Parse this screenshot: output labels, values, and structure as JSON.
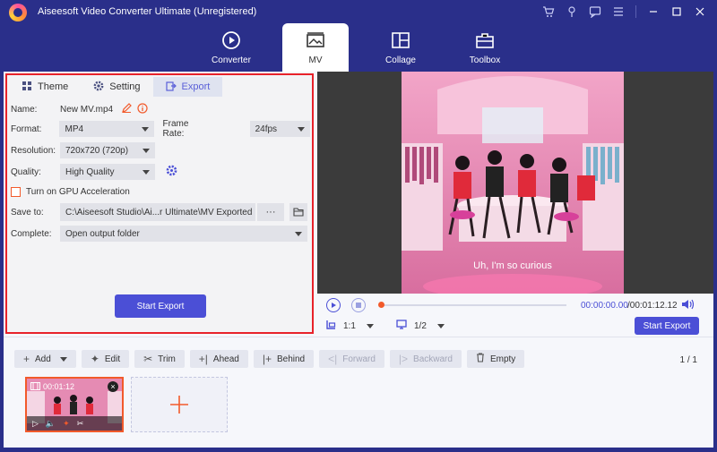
{
  "window": {
    "title": "Aiseesoft Video Converter Ultimate (Unregistered)"
  },
  "nav": {
    "converter": "Converter",
    "mv": "MV",
    "collage": "Collage",
    "toolbox": "Toolbox"
  },
  "tabs": {
    "theme": "Theme",
    "setting": "Setting",
    "export": "Export"
  },
  "export": {
    "name_label": "Name:",
    "name_value": "New MV.mp4",
    "format_label": "Format:",
    "format_value": "MP4",
    "framerate_label": "Frame Rate:",
    "framerate_value": "24fps",
    "resolution_label": "Resolution:",
    "resolution_value": "720x720 (720p)",
    "quality_label": "Quality:",
    "quality_value": "High Quality",
    "gpu_label": "Turn on GPU Acceleration",
    "saveto_label": "Save to:",
    "saveto_value": "C:\\Aiseesoft Studio\\Ai...r Ultimate\\MV Exported",
    "saveto_more": "···",
    "complete_label": "Complete:",
    "complete_value": "Open output folder",
    "start_button": "Start Export"
  },
  "preview": {
    "subtitle": "Uh, I'm so curious",
    "time_current": "00:00:00.00",
    "time_total": "/00:01:12.12",
    "aspect": "1:1",
    "screen": "1/2",
    "start_button": "Start Export"
  },
  "toolbar": {
    "add": "Add",
    "edit": "Edit",
    "trim": "Trim",
    "ahead": "Ahead",
    "behind": "Behind",
    "forward": "Forward",
    "backward": "Backward",
    "empty": "Empty"
  },
  "timeline": {
    "page": "1 / 1",
    "clip_time": "00:01:12"
  },
  "colors": {
    "accent": "#4b4fd6",
    "highlight": "#e8222a",
    "orange": "#f25a2b",
    "bar": "#2a2f8a"
  }
}
